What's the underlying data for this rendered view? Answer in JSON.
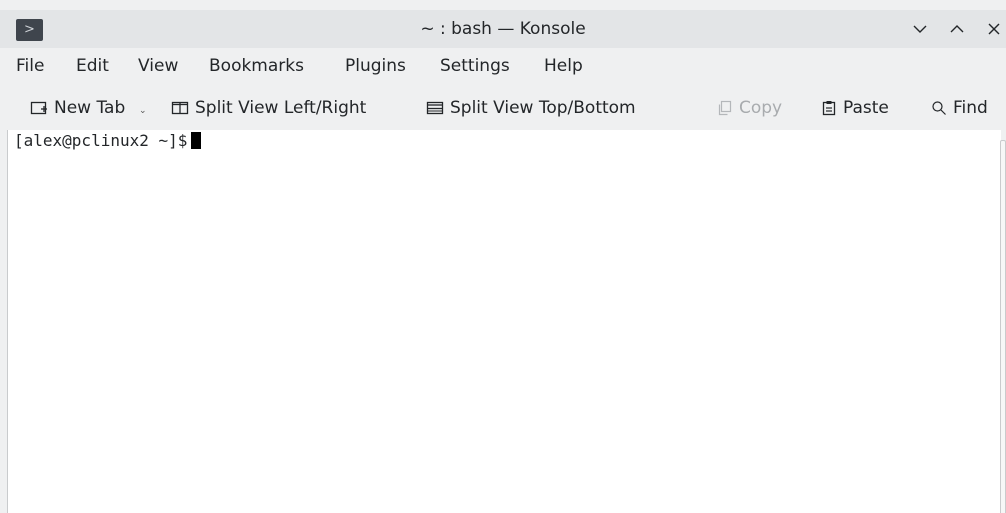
{
  "window": {
    "title": "~ : bash — Konsole"
  },
  "menubar": {
    "items": [
      "File",
      "Edit",
      "View",
      "Bookmarks",
      "Plugins",
      "Settings",
      "Help"
    ]
  },
  "toolbar": {
    "new_tab": "New Tab",
    "split_left_right": "Split View Left/Right",
    "split_top_bottom": "Split View Top/Bottom",
    "copy": "Copy",
    "paste": "Paste",
    "find": "Find"
  },
  "terminal": {
    "prompt": "[alex@pclinux2 ~]$"
  },
  "icons": {
    "app": "konsole-app-icon",
    "new_tab": "new-tab-icon",
    "split_lr": "split-left-right-icon",
    "split_tb": "split-top-bottom-icon",
    "copy": "copy-icon",
    "paste": "paste-icon",
    "find": "search-icon",
    "minimize": "chevron-down-icon",
    "maximize": "chevron-up-icon",
    "close": "close-icon"
  }
}
